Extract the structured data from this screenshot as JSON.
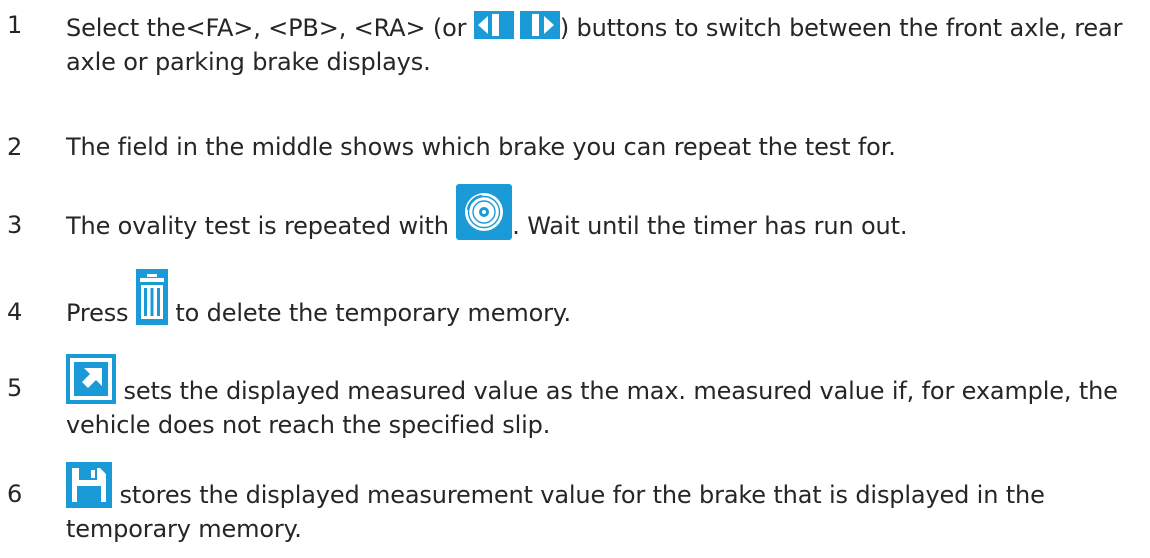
{
  "steps": [
    {
      "number": "1",
      "pre": "Select the<FA>, <PB>, <RA> (or ",
      "icon": "nav-arrows-icon",
      "post": ") buttons to switch between the front axle, rear axle or parking brake displays."
    },
    {
      "number": "2",
      "text": "The field in the middle shows which brake you can repeat the test for."
    },
    {
      "number": "3",
      "pre": "The ovality test is repeated with ",
      "icon": "brake-disc-icon",
      "post": ". Wait until the timer has run out."
    },
    {
      "number": "4",
      "pre": "Press ",
      "icon": "trash-icon",
      "post": " to delete the temporary memory."
    },
    {
      "number": "5",
      "icon": "set-max-icon",
      "post": " sets the displayed measured value as the max. measured value if, for example, the vehicle does not reach the specified slip."
    },
    {
      "number": "6",
      "icon": "save-icon",
      "post": " stores the displayed measurement value for the brake that is displayed in the temporary memory."
    }
  ],
  "colors": {
    "icon_blue": "#1a9ad6",
    "text": "#262626"
  }
}
